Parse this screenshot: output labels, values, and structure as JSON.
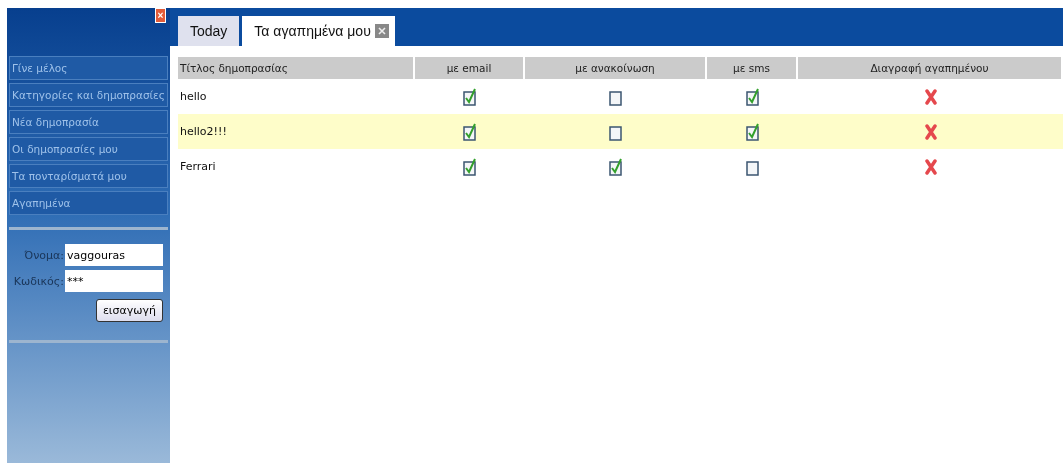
{
  "sidebar": {
    "close": "×",
    "menu": [
      {
        "label": "Γίνε μέλος"
      },
      {
        "label": "Κατηγορίες και δημοπρασίες"
      },
      {
        "label": "Νέα δημοπρασία"
      },
      {
        "label": "Οι δημοπρασίες μου"
      },
      {
        "label": "Τα πονταρίσματά μου"
      },
      {
        "label": "Αγαπημένα"
      }
    ],
    "login": {
      "username_label": "Όνομα:",
      "username": "vaggouras",
      "password_label": "Κωδικός:",
      "password": "***",
      "submit": "εισαγωγή"
    }
  },
  "tabs": [
    {
      "label": "Today",
      "selected": false,
      "closable": false
    },
    {
      "label": "Τα αγαπημένα μου",
      "selected": true,
      "closable": true
    }
  ],
  "table": {
    "columns": [
      "Τίτλος δημοπρασίας",
      "με email",
      "με ανακοίνωση",
      "με sms",
      "Διαγραφή αγαπημένου"
    ],
    "rows": [
      {
        "title": "hello",
        "highlighted": false,
        "email": true,
        "announcement": false,
        "sms": true
      },
      {
        "title": "hello2!!!",
        "highlighted": true,
        "email": true,
        "announcement": false,
        "sms": true
      },
      {
        "title": "Ferrari",
        "highlighted": false,
        "email": true,
        "announcement": true,
        "sms": false
      }
    ]
  }
}
